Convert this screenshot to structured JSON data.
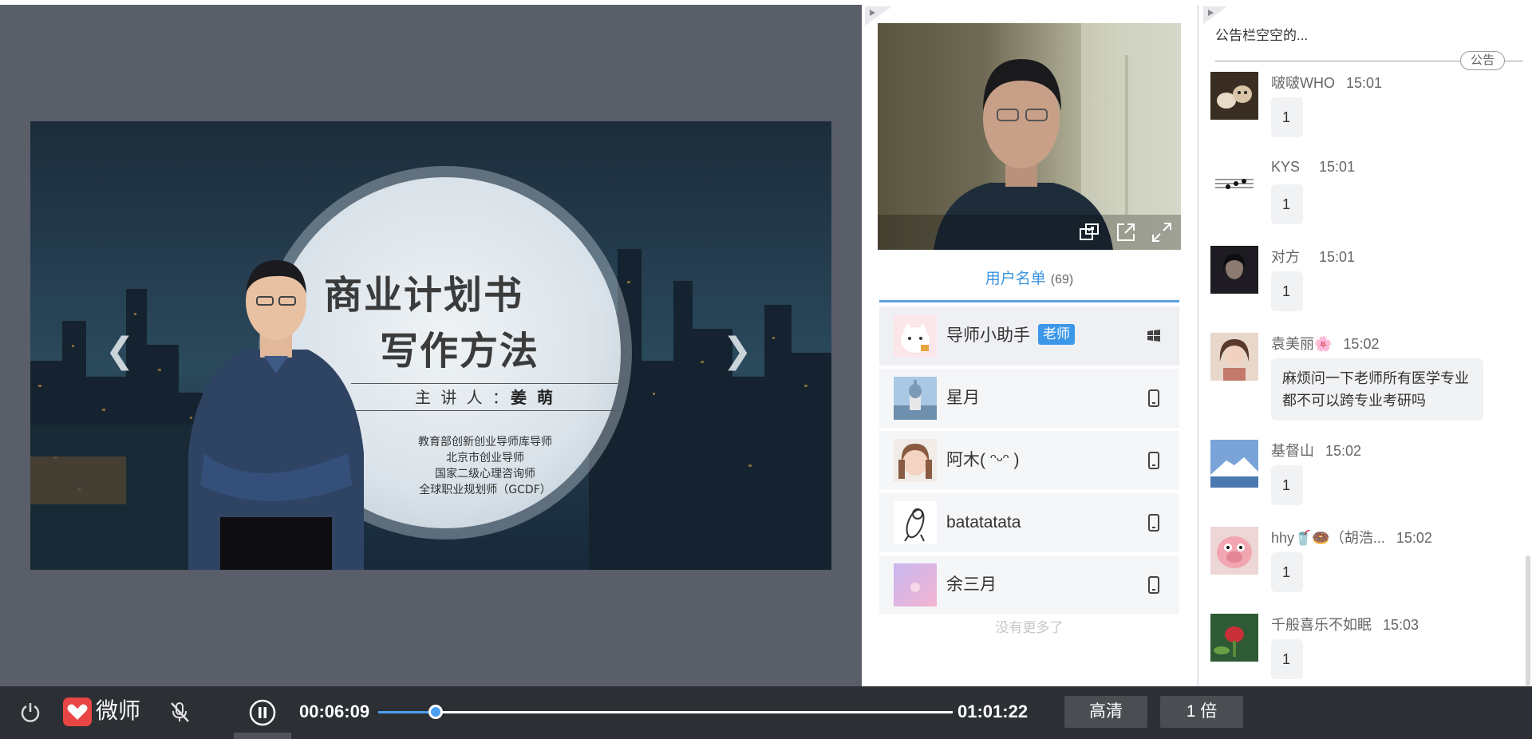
{
  "slide": {
    "title_line1": "商业计划书",
    "title_line2": "写作方法",
    "speaker_label": "主 讲 人 ：",
    "speaker_name": "姜 萌",
    "credentials": [
      "教育部创新创业导师库导师",
      "北京市创业导师",
      "国家二级心理咨询师",
      "全球职业规划师（GCDF）"
    ]
  },
  "user_list": {
    "tab_label": "用户名单",
    "count": "(69)",
    "users": [
      {
        "name": "导师小助手",
        "badge": "老师",
        "device": "windows-icon"
      },
      {
        "name": "星月",
        "device": "phone-icon"
      },
      {
        "name": "阿木( ᵔᵕᵔ )",
        "device": "phone-icon"
      },
      {
        "name": "batatatata",
        "device": "phone-icon"
      },
      {
        "name": "余三月",
        "device": "phone-icon"
      }
    ],
    "no_more": "没有更多了"
  },
  "chat": {
    "notice_text": "公告栏空空的...",
    "notice_tag": "公告",
    "messages": [
      {
        "user": "啵啵WHO",
        "time": "15:01",
        "text": "1"
      },
      {
        "user": "KYS",
        "time": "15:01",
        "text": "1"
      },
      {
        "user": "对方",
        "time": "15:01",
        "text": "1"
      },
      {
        "user": "袁美丽🌸",
        "time": "15:02",
        "text": "麻烦问一下老师所有医学专业都不可以跨专业考研吗"
      },
      {
        "user": "基督山",
        "time": "15:02",
        "text": "1"
      },
      {
        "user": "hhy🥤🍩（胡浩...",
        "time": "15:02",
        "text": "1"
      },
      {
        "user": "千般喜乐不如眠",
        "time": "15:03",
        "text": "1"
      }
    ]
  },
  "player": {
    "brand": "微师",
    "current_time": "00:06:09",
    "total_time": "01:01:22",
    "progress": 0.1003,
    "quality": "高清",
    "speed": "1 倍"
  },
  "colors": {
    "accent": "#4c9ff0",
    "badge": "#3d97e8",
    "brand_red": "#e84545",
    "control_bg": "#2c2f33",
    "slide_bg": "#5a5e69"
  }
}
